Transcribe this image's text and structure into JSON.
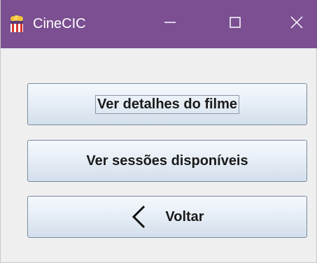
{
  "window": {
    "title": "CineCIC",
    "icon": "cinema-popcorn-icon",
    "controls": [
      "minimize-icon",
      "maximize-icon",
      "close-icon"
    ],
    "titlebar_color": "#7b4f92"
  },
  "buttons": {
    "details_label": "Ver detalhes do filme",
    "sessions_label": "Ver sessões disponíveis",
    "back_label": "Voltar",
    "back_icon": "chevron-left-icon"
  }
}
